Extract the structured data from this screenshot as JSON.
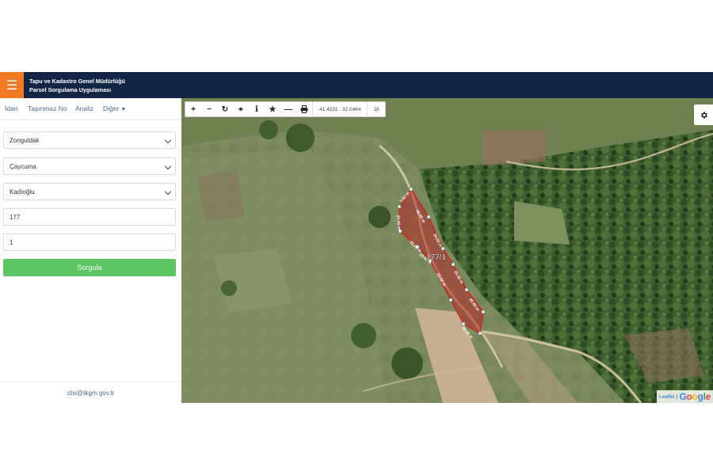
{
  "header": {
    "menu_icon": "hamburger-icon",
    "title_line1": "Tapu ve Kadastro Genel Müdürlüğü",
    "title_line2": "Parsel Sorgulama Uygulaması",
    "background": "#132545",
    "accent": "#f37a22"
  },
  "tabs": [
    {
      "label": "İdari"
    },
    {
      "label": "Taşınmaz No"
    },
    {
      "label": "Analiz"
    },
    {
      "label": "Diğer"
    }
  ],
  "form": {
    "province": "Zonguldak",
    "district": "Çaycuma",
    "neighborhood": "Kadıoğlu",
    "block_no": "177",
    "parcel_no": "1",
    "query_button": "Sorgula",
    "button_color": "#5cc762"
  },
  "footer": {
    "email": "cbs@tkgm.gov.tr"
  },
  "map": {
    "toolbar_icons": [
      "plus-icon",
      "minus-icon",
      "refresh-icon",
      "locate-icon",
      "info-icon",
      "star-icon",
      "measure-line-icon",
      "print-icon"
    ],
    "coordinates": "41.4231 : 32.0464",
    "zoom_level": "16",
    "parcel_label": "177/1",
    "parcel_color": "#c0262c",
    "edge_labels": [
      "7.62 m",
      "48.05 m",
      "34.03 m",
      "25.50 m",
      "25.80 m",
      "26.45 m",
      "23.68 m",
      "32.30 m",
      "27.46 m",
      "19.82 m"
    ],
    "attribution_leaflet": "Leaflet",
    "attribution_separator": "|",
    "attribution_google": "Google",
    "settings_icon": "gear-icon"
  }
}
